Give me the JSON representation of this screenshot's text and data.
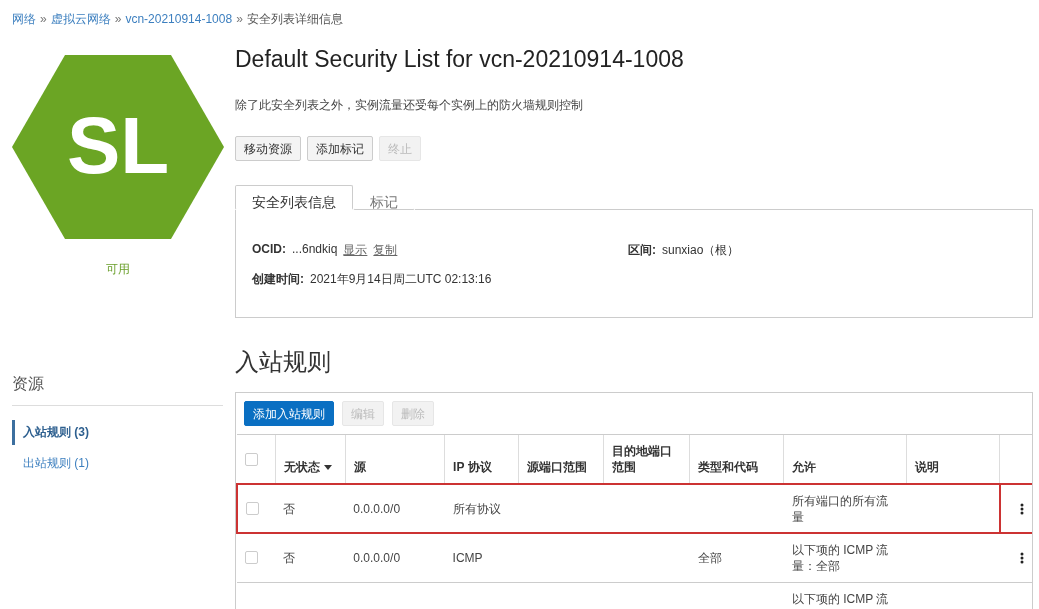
{
  "breadcrumb": [
    {
      "label": "网络",
      "kind": "link"
    },
    {
      "label": "»",
      "kind": "separator"
    },
    {
      "label": "虚拟云网络",
      "kind": "link"
    },
    {
      "label": "»",
      "kind": "separator"
    },
    {
      "label": "vcn-20210914-1008",
      "kind": "link"
    },
    {
      "label": "»",
      "kind": "separator"
    },
    {
      "label": "安全列表详细信息",
      "kind": "current"
    }
  ],
  "badge": {
    "initials": "SL",
    "status": "可用"
  },
  "title": "Default Security List for vcn-20210914-1008",
  "description": "除了此安全列表之外，实例流量还受每个实例上的防火墙规则控制",
  "actions": [
    {
      "label": "移动资源",
      "disabled": false
    },
    {
      "label": "添加标记",
      "disabled": false
    },
    {
      "label": "终止",
      "disabled": true
    }
  ],
  "tabs": [
    {
      "label": "安全列表信息",
      "selected": true
    },
    {
      "label": "标记",
      "selected": false
    }
  ],
  "info": {
    "ocid_label": "OCID:",
    "ocid_value": "...6ndkiq",
    "show_link": "显示",
    "copy_link": "复制",
    "compartment_label": "区间:",
    "compartment_value": "sunxiao（根）",
    "created_label": "创建时间:",
    "created_value": "2021年9月14日周二UTC 02:13:16"
  },
  "resources": {
    "title": "资源",
    "items": [
      {
        "label": "入站规则 (3)",
        "selected": true
      },
      {
        "label": "出站规则 (1)",
        "selected": false
      }
    ]
  },
  "section_title": "入站规则",
  "table_buttons": [
    {
      "label": "添加入站规则",
      "kind": "primary",
      "disabled": false
    },
    {
      "label": "编辑",
      "kind": "default",
      "disabled": true
    },
    {
      "label": "删除",
      "kind": "default",
      "disabled": true
    }
  ],
  "table": {
    "select_all_checked": false,
    "columns": [
      "无状态",
      "源",
      "IP 协议",
      "源端口范围",
      "目的地端口范围",
      "类型和代码",
      "允许",
      "说明"
    ],
    "rows": [
      {
        "checked": false,
        "highlighted": true,
        "cells": [
          "否",
          "0.0.0.0/0",
          "所有协议",
          "",
          "",
          "",
          "所有端口的所有流量",
          ""
        ]
      },
      {
        "checked": false,
        "highlighted": false,
        "cells": [
          "否",
          "0.0.0.0/0",
          "ICMP",
          "",
          "",
          "全部",
          "以下项的 ICMP 流量：全部",
          ""
        ]
      },
      {
        "partial": true,
        "cells": [
          "",
          "",
          "",
          "",
          "",
          "",
          "以下项的 ICMP 流",
          ""
        ]
      }
    ]
  }
}
